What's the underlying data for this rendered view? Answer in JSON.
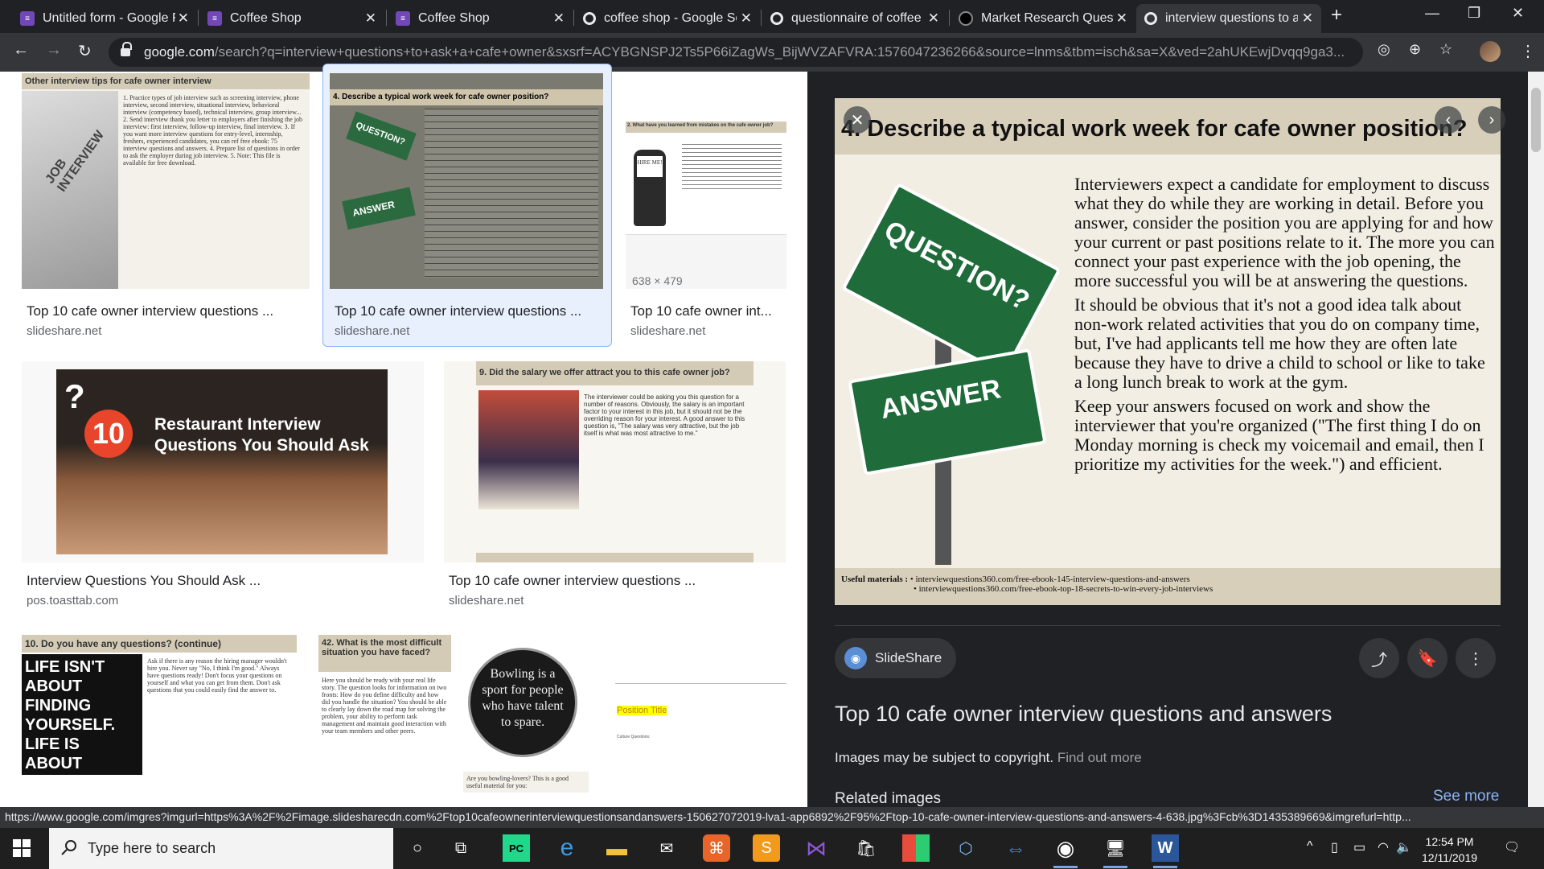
{
  "tabs": [
    {
      "title": "Untitled form - Google Forms",
      "icon": "forms-icon"
    },
    {
      "title": "Coffee Shop",
      "icon": "forms-icon"
    },
    {
      "title": "Coffee Shop",
      "icon": "forms-icon"
    },
    {
      "title": "coffee shop - Google Search",
      "icon": "google-icon"
    },
    {
      "title": "questionnaire of coffee shop",
      "icon": "google-icon"
    },
    {
      "title": "Market Research Question",
      "icon": "site-icon"
    },
    {
      "title": "interview questions to ask",
      "icon": "google-icon",
      "active": true
    }
  ],
  "omnibox": {
    "host": "google.com",
    "path": "/search?q=interview+questions+to+ask+a+cafe+owner&sxsrf=ACYBGNSPJ2Ts5P66iZagWs_BijWVZAFVRA:1576047236266&source=lnms&tbm=isch&sa=X&ved=2ahUKEwjDvqq9ga3..."
  },
  "results": {
    "r1": {
      "title": "Top 10 cafe owner interview questions ...",
      "source": "slideshare.net",
      "thumb_heading": "Other interview tips for cafe owner interview",
      "thumb_text": "1. Practice types of job interview such as screening interview, phone interview, second interview, situational interview, behavioral interview (competency based), technical interview, group interview... 2. Send interview thank you letter to employers after finishing the job interview: first interview, follow-up interview, final interview. 3. If you want more interview questions for entry-level, internship, freshers, experienced candidates, you can ref free ebook: 75 interview questions and answers. 4. Prepare list of questions in order to ask the employer during job interview. 5. Note: This file is available for free download."
    },
    "r2": {
      "title": "Top 10 cafe owner interview questions ...",
      "source": "slideshare.net",
      "thumb_heading": "4. Describe a typical work week for cafe owner position?"
    },
    "r3": {
      "title": "Top 10 cafe owner int...",
      "source": "slideshare.net",
      "thumb_heading": "2. What have you learned from mistakes on the cafe owner job?",
      "dims": "638 × 479",
      "sign": "HIRE ME!"
    },
    "r4": {
      "title": "Interview Questions You Should Ask ...",
      "source": "pos.toasttab.com",
      "banner_num": "10",
      "banner_text": "Restaurant Interview Questions You Should Ask"
    },
    "r5": {
      "title": "Top 10 cafe owner interview questions ...",
      "source": "slideshare.net",
      "thumb_heading": "9. Did the salary we offer attract you to this cafe owner job?",
      "thumb_text": "The interviewer could be asking you this question for a number of reasons. Obviously, the salary is an important factor to your interest in this job, but it should not be the overriding reason for your interest. A good answer to this question is, \"The salary was very attractive, but the job itself is what was most attractive to me.\""
    },
    "r6": {
      "thumb_heading": "10. Do you have any questions? (continue)",
      "poster": "LIFE ISN'T ABOUT FINDING YOURSELF. LIFE IS ABOUT CREATING YOURSELF.",
      "thumb_text": "Ask if there is any reason the hiring manager wouldn't hire you. Never say \"No, I think I'm good.\" Always have questions ready! Don't focus your questions on yourself and what you can get from them. Don't ask questions that you could easily find the answer to."
    },
    "r7": {
      "thumb_heading": "42. What is the most difficult situation you have faced?",
      "thumb_text": "Here you should be ready with your real life story. The question looks for information on two fronts: How do you define difficulty and how did you handle the situation? You should be able to clearly lay down the road map for solving the problem, your ability to perform task management and maintain good interaction with your team members and other peers.",
      "badge": "Bowling is a sport for people who have talent to spare.",
      "badge_caption": "Are you bowling-lovers? This is a good useful material for you:"
    },
    "r8": {
      "doc_title": "Position Title",
      "doc_sub": "Culture Questions:"
    }
  },
  "preview": {
    "heading": "4. Describe a typical work week for cafe owner position?",
    "sign_top": "QUESTION?",
    "sign_bottom": "ANSWER",
    "para1": "Interviewers expect a candidate for employment to discuss what they do while they are working in detail. Before you answer, consider the position you are applying for and how your current or past positions relate to it. The more you can connect your past experience with the job opening, the more successful you will be at answering the questions.",
    "para2": "It should be obvious that it's not a good idea talk about non-work related activities that you do on company time, but, I've had applicants tell me how they are often late because they have to drive a child to school or like to take a long lunch break to work at the gym.",
    "para3": "Keep your answers focused on work and show the interviewer that you're organized (\"The first thing I do on Monday morning is check my voicemail and email, then I prioritize my activities for the week.\") and efficient.",
    "foot_label": "Useful materials :",
    "foot1": "• interviewquestions360.com/free-ebook-145-interview-questions-and-answers",
    "foot2": "• interviewquestions360.com/free-ebook-top-18-secrets-to-win-every-job-interviews",
    "source_chip": "SlideShare",
    "title": "Top 10 cafe owner interview questions and answers",
    "copyright": "Images may be subject to copyright.",
    "find_out_more": "Find out more",
    "related": "Related images",
    "see_more": "See more"
  },
  "status_url": "https://www.google.com/imgres?imgurl=https%3A%2F%2Fimage.slidesharecdn.com%2Ftop10cafeownerinterviewquestionsandanswers-150627072019-lva1-app6892%2F95%2Ftop-10-cafe-owner-interview-questions-and-answers-4-638.jpg%3Fcb%3D1435389669&imgrefurl=http...",
  "taskbar": {
    "search_placeholder": "Type here to search",
    "time": "12:54 PM",
    "date": "12/11/2019"
  },
  "colors": {
    "accent": "#8ab4f8",
    "dark_bg": "#202124",
    "sign_green": "#1f6b3a"
  }
}
